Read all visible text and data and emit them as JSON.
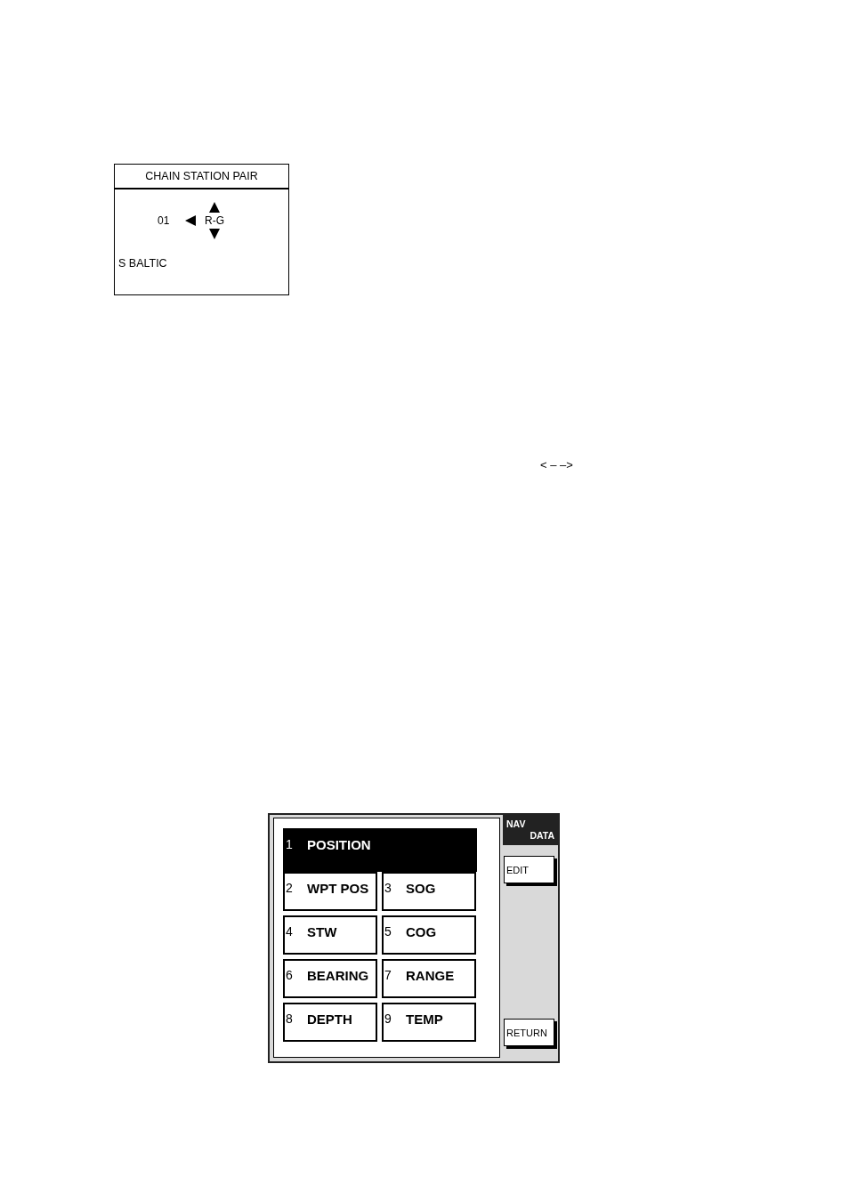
{
  "chain_panel": {
    "title": "CHAIN STATION PAIR",
    "number": "01",
    "pair": "R-G",
    "chain": "S BALTIC"
  },
  "floating_text": "< – –>",
  "nav_panel": {
    "title_lines": [
      "NAV",
      "DATA"
    ],
    "items": [
      {
        "number": "1",
        "label": "POSITION",
        "selected": true
      },
      {
        "number": "2",
        "label": "WPT POS",
        "selected": false
      },
      {
        "number": "3",
        "label": "SOG",
        "selected": false
      },
      {
        "number": "4",
        "label": "STW",
        "selected": false
      },
      {
        "number": "5",
        "label": "COG",
        "selected": false
      },
      {
        "number": "6",
        "label": "BEARING",
        "selected": false
      },
      {
        "number": "7",
        "label": "RANGE",
        "selected": false
      },
      {
        "number": "8",
        "label": "DEPTH",
        "selected": false
      },
      {
        "number": "9",
        "label": "TEMP",
        "selected": false
      }
    ],
    "buttons": [
      "EDIT",
      "RETURN"
    ]
  }
}
